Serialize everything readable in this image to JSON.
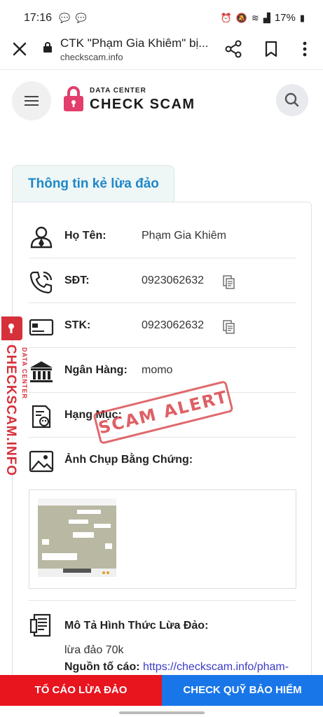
{
  "status_bar": {
    "time": "17:16",
    "notifications": "💬 💬",
    "battery": "17%"
  },
  "browser": {
    "title": "CTK \"Phạm Gia Khiêm\" bị...",
    "url": "checkscam.info"
  },
  "site": {
    "logo_small": "DATA CENTER",
    "logo_big": "CHECK SCAM"
  },
  "card": {
    "tab_title": "Thông tin kẻ lừa đảo",
    "rows": [
      {
        "label": "Họ Tên:",
        "value": "Phạm Gia Khiêm",
        "icon": "person-icon"
      },
      {
        "label": "SĐT:",
        "value": "0923062632",
        "icon": "phone-icon"
      },
      {
        "label": "STK:",
        "value": "0923062632",
        "icon": "card-icon"
      },
      {
        "label": "Ngân Hàng:",
        "value": "momo",
        "icon": "bank-icon"
      },
      {
        "label": "Hạng Mục:",
        "value": "",
        "icon": "category-icon"
      },
      {
        "label": "Ảnh Chụp Bằng Chứng:",
        "value": "",
        "icon": "image-icon"
      }
    ],
    "description_label": "Mô Tả Hình Thức Lừa Đảo:",
    "description_value": "lừa đảo 70k",
    "source_label": "Nguồn tố cáo:",
    "source_link": "https://checkscam.info/pham-"
  },
  "stamp_text": "SCAM ALERT",
  "side_badge": {
    "vertical_text": "CHECKSCAM.INFO",
    "vertical_small": "DATA CENTER"
  },
  "bottom": {
    "report_label": "TỐ CÁO LỪA ĐẢO",
    "insurance_label": "CHECK QUỸ BẢO HIỂM"
  },
  "colors": {
    "accent_blue": "#1e88c8",
    "report_red": "#e8141e",
    "insurance_blue": "#1976e8",
    "brand_red": "#d6303a"
  }
}
